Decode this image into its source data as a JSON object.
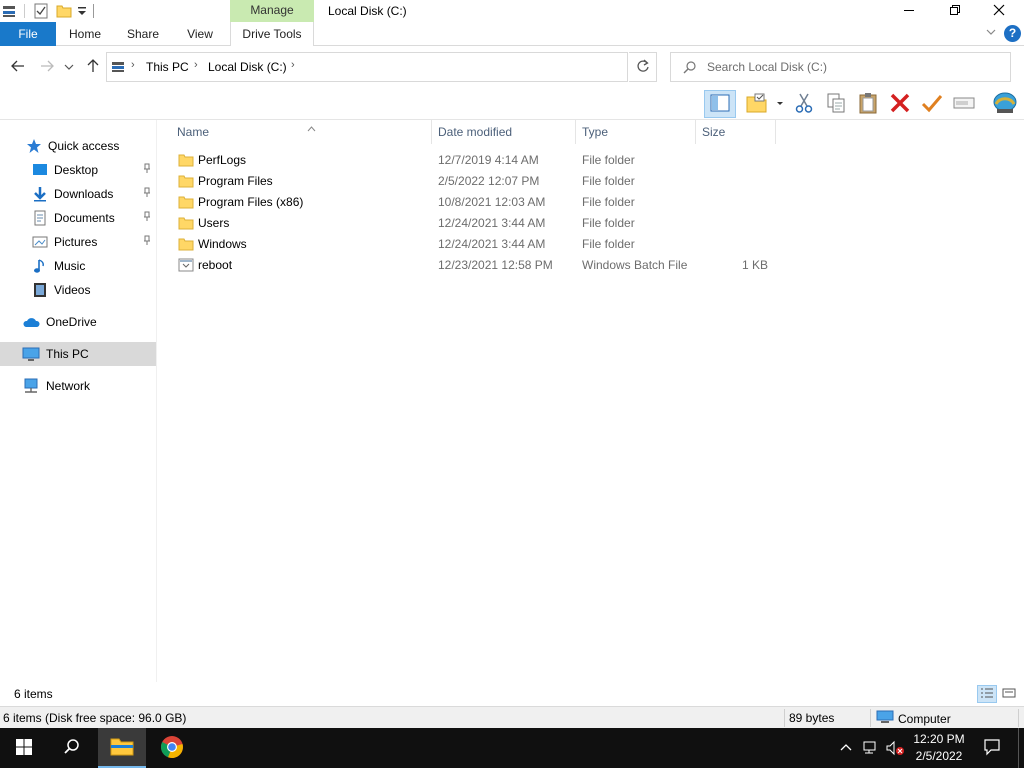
{
  "title_bar": {
    "contextual_tab": "Manage",
    "window_title": "Local Disk (C:)",
    "minimize_icon": "minimize-icon",
    "restore_icon": "restore-icon",
    "close_icon": "close-icon"
  },
  "ribbon": {
    "tabs": [
      "File",
      "Home",
      "Share",
      "View",
      "Drive Tools"
    ],
    "help_label": "?"
  },
  "address_bar": {
    "breadcrumbs": [
      "This PC",
      "Local Disk (C:)"
    ],
    "search_placeholder": "Search Local Disk (C:)"
  },
  "toolbar": {
    "buttons": [
      "preview-pane-icon",
      "new-folder-icon",
      "cut-icon",
      "copy-icon",
      "paste-icon",
      "delete-icon",
      "apply-icon",
      "rename-icon",
      "properties-icon"
    ]
  },
  "nav": {
    "quick_access": "Quick access",
    "items": [
      {
        "label": "Desktop",
        "pinned": true
      },
      {
        "label": "Downloads",
        "pinned": true
      },
      {
        "label": "Documents",
        "pinned": true
      },
      {
        "label": "Pictures",
        "pinned": true
      },
      {
        "label": "Music",
        "pinned": false
      },
      {
        "label": "Videos",
        "pinned": false
      }
    ],
    "onedrive": "OneDrive",
    "this_pc": "This PC",
    "network": "Network"
  },
  "columns": {
    "name": "Name",
    "date": "Date modified",
    "type": "Type",
    "size": "Size"
  },
  "files": [
    {
      "name": "PerfLogs",
      "date": "12/7/2019 4:14 AM",
      "type": "File folder",
      "size": ""
    },
    {
      "name": "Program Files",
      "date": "2/5/2022 12:07 PM",
      "type": "File folder",
      "size": ""
    },
    {
      "name": "Program Files (x86)",
      "date": "10/8/2021 12:03 AM",
      "type": "File folder",
      "size": ""
    },
    {
      "name": "Users",
      "date": "12/24/2021 3:44 AM",
      "type": "File folder",
      "size": ""
    },
    {
      "name": "Windows",
      "date": "12/24/2021 3:44 AM",
      "type": "File folder",
      "size": ""
    },
    {
      "name": "reboot",
      "date": "12/23/2021 12:58 PM",
      "type": "Windows Batch File",
      "size": "1 KB"
    }
  ],
  "status": {
    "item_count": "6 items",
    "disk_info": "6 items (Disk free space: 96.0 GB)",
    "bytes": "89 bytes",
    "location": "Computer"
  },
  "taskbar": {
    "time": "12:20 PM",
    "date": "2/5/2022"
  },
  "colors": {
    "accent": "#1979ca",
    "manage_tab": "#c9eab1",
    "selected_nav": "#d9d9d9",
    "taskbar": "#101010"
  }
}
